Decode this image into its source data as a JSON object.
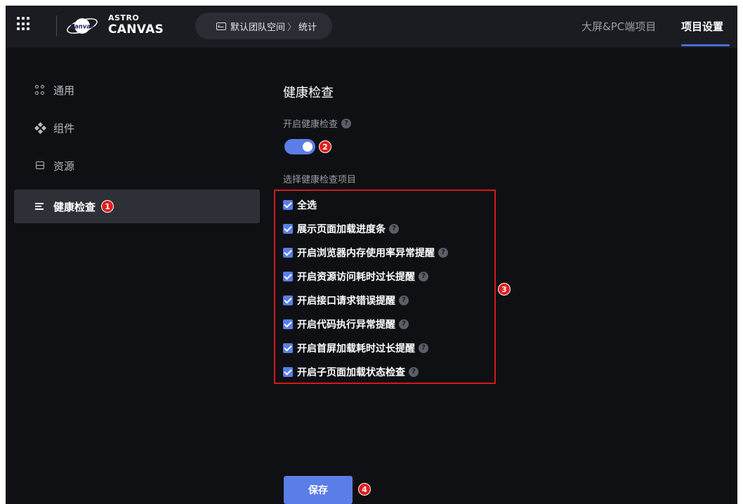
{
  "header": {
    "logo_top": "ASTRO",
    "logo_bottom": "CANVAS",
    "logo_mark_text": "Canvas",
    "breadcrumb": {
      "workspace": "默认团队空间",
      "separator": "〉",
      "page": "统计"
    },
    "tabs": [
      {
        "label": "大屏&PC端项目"
      },
      {
        "label": "项目设置"
      }
    ]
  },
  "sidebar": {
    "items": [
      {
        "label": "通用",
        "icon": "grid-icon"
      },
      {
        "label": "组件",
        "icon": "component-icon"
      },
      {
        "label": "资源",
        "icon": "layers-icon"
      },
      {
        "label": "健康检查",
        "icon": "list-icon",
        "badge": "1"
      }
    ]
  },
  "main": {
    "title": "健康检查",
    "enable_label": "开启健康检查",
    "enable_badge": "2",
    "toggle_on": true,
    "items_label": "选择健康检查项目",
    "items_badge": "3",
    "help_glyph": "?",
    "checkboxes": [
      {
        "label": "全选",
        "checked": true
      },
      {
        "label": "展示页面加载进度条",
        "checked": true
      },
      {
        "label": "开启浏览器内存使用率异常提醒",
        "checked": true
      },
      {
        "label": "开启资源访问耗时过长提醒",
        "checked": true
      },
      {
        "label": "开启接口请求错误提醒",
        "checked": true
      },
      {
        "label": "开启代码执行异常提醒",
        "checked": true
      },
      {
        "label": "开启首屏加载耗时过长提醒",
        "checked": true
      },
      {
        "label": "开启子页面加载状态检查",
        "checked": true
      }
    ],
    "save_label": "保存",
    "save_badge": "4"
  },
  "colors": {
    "accent": "#5b7de8",
    "badge": "#e01e1e",
    "background": "#0f1013",
    "header": "#1b1c21"
  }
}
